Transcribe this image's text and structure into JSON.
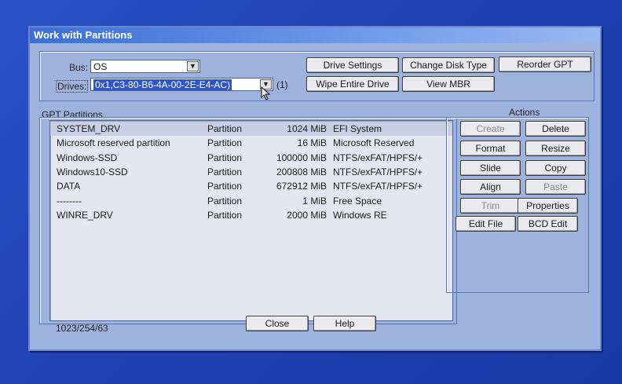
{
  "window": {
    "title": "Work with Partitions"
  },
  "top": {
    "bus_label": "Bus:",
    "bus_value": "OS",
    "drives_label": "Drives:",
    "drives_value": "0x1,C3-80-B6-4A-00-2E-E4-AC)",
    "drives_count": "(1)",
    "buttons": {
      "drive_settings": "Drive Settings",
      "change_disk_type": "Change Disk Type",
      "reorder_gpt": "Reorder GPT",
      "wipe_entire_drive": "Wipe Entire Drive",
      "view_mbr": "View MBR"
    }
  },
  "partitions": {
    "label": "GPT Partitions",
    "rows": [
      {
        "name": "SYSTEM_DRV",
        "type": "Partition",
        "size": "1024 MiB",
        "fs": "EFI System"
      },
      {
        "name": "Microsoft reserved partition",
        "type": "Partition",
        "size": "16 MiB",
        "fs": "Microsoft Reserved"
      },
      {
        "name": "Windows-SSD",
        "type": "Partition",
        "size": "100000 MiB",
        "fs": "NTFS/exFAT/HPFS/+"
      },
      {
        "name": "Windows10-SSD",
        "type": "Partition",
        "size": "200808 MiB",
        "fs": "NTFS/exFAT/HPFS/+"
      },
      {
        "name": "DATA",
        "type": "Partition",
        "size": "672912 MiB",
        "fs": "NTFS/exFAT/HPFS/+"
      },
      {
        "name": "--------",
        "type": "Partition",
        "size": "1 MiB",
        "fs": "Free Space"
      },
      {
        "name": "WINRE_DRV",
        "type": "Partition",
        "size": "2000 MiB",
        "fs": "Windows RE"
      }
    ]
  },
  "actions": {
    "label": "Actions",
    "create": "Create",
    "delete": "Delete",
    "format": "Format",
    "resize": "Resize",
    "slide": "Slide",
    "copy": "Copy",
    "align": "Align",
    "paste": "Paste",
    "trim": "Trim",
    "properties": "Properties",
    "edit_file": "Edit File",
    "bcd_edit": "BCD Edit"
  },
  "footer": {
    "geometry": "1023/254/63",
    "close": "Close",
    "help": "Help"
  }
}
